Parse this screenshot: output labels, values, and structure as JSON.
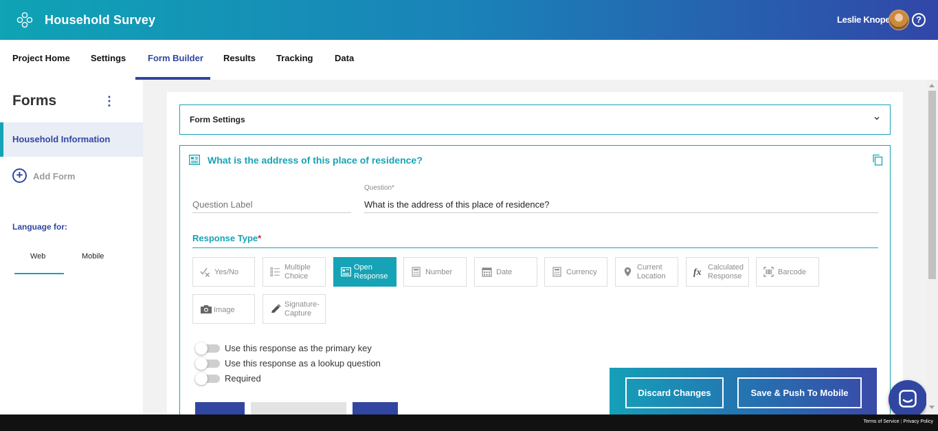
{
  "header": {
    "title": "Household Survey",
    "user_name": "Leslie Knope",
    "help_glyph": "?",
    "logo_icon": "flower-logo-icon",
    "colors": {
      "gradient_start": "#0fa3b5",
      "gradient_end": "#3147a8"
    }
  },
  "nav": {
    "tabs": [
      {
        "label": "Project Home"
      },
      {
        "label": "Settings"
      },
      {
        "label": "Form Builder",
        "active": true
      },
      {
        "label": "Results"
      },
      {
        "label": "Tracking"
      },
      {
        "label": "Data"
      }
    ]
  },
  "sidebar": {
    "title": "Forms",
    "menu_glyph": "⋮",
    "forms": [
      {
        "label": "Household Information",
        "selected": true
      }
    ],
    "add_form_label": "Add Form",
    "language_label": "Language for:",
    "language_tabs": [
      {
        "label": "Web",
        "active": true
      },
      {
        "label": "Mobile"
      }
    ]
  },
  "form_settings": {
    "label": "Form Settings"
  },
  "question": {
    "title": "What is the address of this place of residence?",
    "label_placeholder": "Question Label",
    "question_caption": "Question*",
    "question_value": "What is the address of this place of residence?",
    "response_type_label": "Response Type",
    "required_mark": "*",
    "response_types": [
      {
        "label": "Yes/No",
        "icon": "yes-no-icon"
      },
      {
        "label": "Multiple Choice",
        "icon": "list-icon"
      },
      {
        "label": "Open Response",
        "icon": "text-box-icon",
        "selected": true
      },
      {
        "label": "Number",
        "icon": "calculator-icon"
      },
      {
        "label": "Date",
        "icon": "calendar-icon"
      },
      {
        "label": "Currency",
        "icon": "calculator-icon"
      },
      {
        "label": "Current Location",
        "icon": "map-pin-icon"
      },
      {
        "label": "Calculated Response",
        "icon": "function-icon"
      },
      {
        "label": "Barcode",
        "icon": "barcode-scan-icon"
      },
      {
        "label": "Image",
        "icon": "camera-icon"
      },
      {
        "label": "Signature-Capture",
        "icon": "pen-icon"
      }
    ],
    "toggles": [
      {
        "label": "Use this response as the primary key",
        "on": false
      },
      {
        "label": "Use this response as a lookup question",
        "on": false
      },
      {
        "label": "Required",
        "on": false
      }
    ]
  },
  "actions": {
    "discard_label": "Discard Changes",
    "save_label": "Save & Push To Mobile"
  },
  "footer": {
    "terms_label": "Terms of Service",
    "separator": "|",
    "privacy_label": "Privacy Policy"
  }
}
